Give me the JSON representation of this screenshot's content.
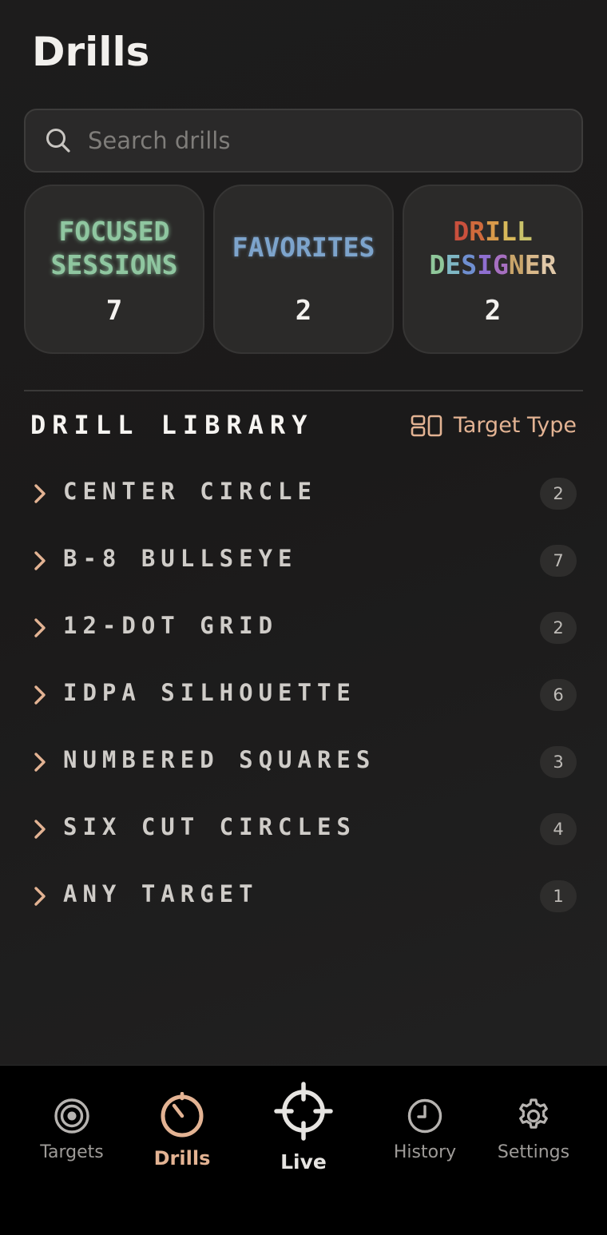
{
  "header": {
    "title": "Drills"
  },
  "search": {
    "placeholder": "Search drills"
  },
  "cards": [
    {
      "label_lines": [
        "FOCUSED",
        "SESSIONS"
      ],
      "count": "7"
    },
    {
      "label_lines": [
        "FAVORITES"
      ],
      "count": "2"
    },
    {
      "label_lines": [
        "DRILL",
        "DESIGNER"
      ],
      "count": "2",
      "letter_colors": [
        "#c9503d",
        "#d06a3c",
        "#d99a4a",
        "#d8b95a",
        "#c9c26a",
        "#8fc79a",
        "#7fb7c4",
        "#6f8fd0",
        "#8f6fd0",
        "#a66fc0",
        "#c9a56a",
        "#d9b88a",
        "#e0c8a8"
      ]
    }
  ],
  "library": {
    "title": "DRILL LIBRARY",
    "filter_label": "Target Type",
    "items": [
      {
        "name": "CENTER CIRCLE",
        "count": "2"
      },
      {
        "name": "B-8 BULLSEYE",
        "count": "7"
      },
      {
        "name": "12-DOT GRID",
        "count": "2"
      },
      {
        "name": "IDPA SILHOUETTE",
        "count": "6"
      },
      {
        "name": "NUMBERED SQUARES",
        "count": "3"
      },
      {
        "name": "SIX CUT CIRCLES",
        "count": "4"
      },
      {
        "name": "ANY TARGET",
        "count": "1"
      }
    ]
  },
  "tabbar": {
    "tabs": [
      {
        "label": "Targets",
        "icon": "target-icon",
        "active": false
      },
      {
        "label": "Drills",
        "icon": "timer-icon",
        "active": true
      },
      {
        "label": "Live",
        "icon": "crosshair-icon",
        "active": false
      },
      {
        "label": "History",
        "icon": "clock-icon",
        "active": false
      },
      {
        "label": "Settings",
        "icon": "gear-icon",
        "active": false
      }
    ]
  },
  "colors": {
    "accent": "#e3b393",
    "background": "#1b1a1a",
    "focused_sessions": "#8fc6a0",
    "favorites": "#7da4cc"
  }
}
